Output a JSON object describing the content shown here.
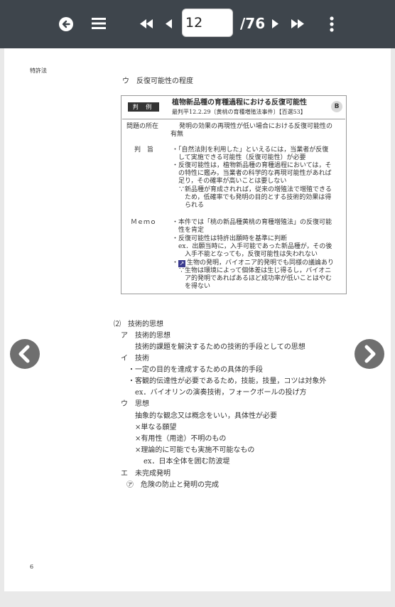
{
  "toolbar": {
    "current_page": "12",
    "total_pages": "/76",
    "icons": [
      "back-circle-icon",
      "menu-icon",
      "first-page-icon",
      "prev-page-icon",
      "next-page-icon",
      "last-page-icon",
      "more-vertical-icon"
    ]
  },
  "page": {
    "header": "特許法",
    "page_number": "6",
    "section_u": "ウ　反復可能性の程度",
    "case": {
      "badge": "判 例",
      "title": "植物新品種の育種過程における反復可能性",
      "citation": "最判平12.2.29〔黄桃の育種増殖法事件〕【百選53】",
      "rank": "B",
      "issue_label": "問題の所在",
      "issue_lines": [
        "発明の効果の再現性が低い場合における反復可能性の",
        "有無"
      ],
      "gist_label": "判　旨",
      "gist_lines": [
        "・「自然法則を利用した」といえるには，当業者が反復",
        "　して実施できる可能性（反復可能性）が必要",
        "・反復可能性は，植物新品種の育種過程においては，そ",
        "　の特性に鑑み，当業者の科学的な再現可能性があれば",
        "　足り，その確率が高いことは要しない",
        "　∵新品種が育成されれば，従来の増殖法で増殖できる",
        "　　ため，低確率でも発明の目的とする技術的効果は得",
        "　　られる"
      ],
      "memo_label": "Ｍｅｍｏ",
      "memo_lines": [
        "・本件では「桃の新品種黄桃の育種増殖法」の反復可能",
        "　性を肯定",
        "・反復可能性は特許出願時を基準に判断",
        "　ex．出願当時に，入手可能であった新品種が，その後",
        "　　入手不能となっても，反復可能性は失われない"
      ],
      "memo_arrow_line": "生物の発明，バイオニア的発明でも同様の議論あり",
      "memo_lines_after": [
        "　∵生物は環境によって個体差は生じ得るし，バイオニ",
        "　　ア的発明であればあるほど成功率が低いことはやむ",
        "　　を得ない"
      ]
    },
    "section2_title": "⑵　技術的思想",
    "section2_lines": [
      {
        "text": "ア　技術的思想",
        "indent": 0
      },
      {
        "text": "技術的課題を解決するための技術的手段としての思想",
        "indent": 2
      },
      {
        "text": "イ　技術",
        "indent": 0
      },
      {
        "text": "・一定の目的を達成するための具体的手段",
        "indent": 1
      },
      {
        "text": "・客観的伝達性が必要であるため，技能，技量，コツは対象外",
        "indent": 1
      },
      {
        "text": "ex．バイオリンの演奏技術，フォークボールの投げ方",
        "indent": 2
      },
      {
        "text": "ウ　思想",
        "indent": 0
      },
      {
        "text": "抽象的な観念又は概念をいい，具体性が必要",
        "indent": 2
      },
      {
        "text": "×単なる願望",
        "indent": 2
      },
      {
        "text": "×有用性（用途）不明のもの",
        "indent": 2
      },
      {
        "text": "×理論的に可能でも実施不可能なもの",
        "indent": 2
      },
      {
        "text": "ex．日本全体を囲む防波堤",
        "indent": 3
      },
      {
        "text": "エ　未完成発明",
        "indent": 0
      },
      {
        "text": "㋐　危険の防止と発明の完成",
        "indent": 1
      }
    ]
  },
  "nav": {
    "prev_icon": "chevron-left-circle-icon",
    "next_icon": "chevron-right-circle-icon"
  }
}
